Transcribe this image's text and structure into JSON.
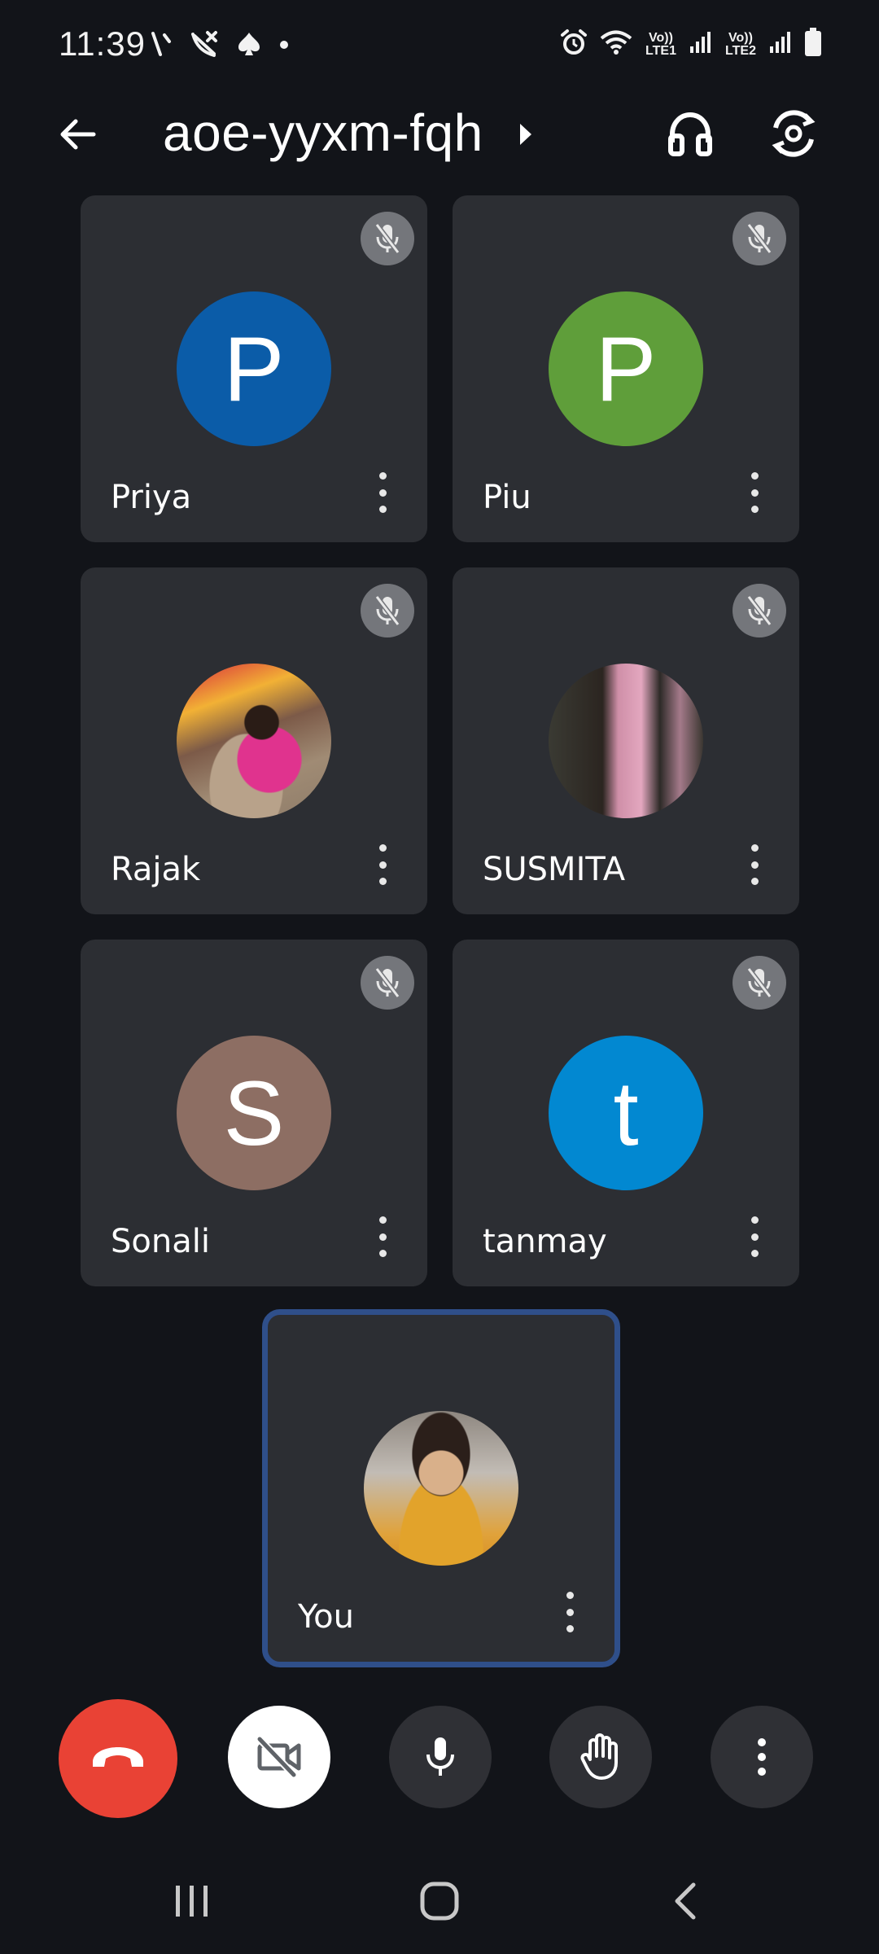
{
  "status_bar": {
    "time": "11:39",
    "icons_left": [
      "missed-call-icon",
      "no-calls-icon",
      "spade-icon",
      "dot-icon"
    ],
    "icons_right": [
      "alarm-icon",
      "wifi-icon",
      "signal-icon",
      "signal-icon",
      "battery-icon"
    ],
    "sim1_label": "Vo)) LTE1",
    "sim2_label": "Vo)) LTE2"
  },
  "top_bar": {
    "meeting_code": "aoe-yyxm-fqh",
    "icons": [
      "back-arrow-icon",
      "caret-right-icon",
      "headphones-icon",
      "switch-camera-icon"
    ]
  },
  "participants": [
    {
      "name": "Priya",
      "initial": "P",
      "avatar_color": "#0b5ca8",
      "muted": true
    },
    {
      "name": "Piu",
      "initial": "P",
      "avatar_color": "#5f9e3a",
      "muted": true
    },
    {
      "name": "Rajak",
      "initial": "",
      "avatar": "photo",
      "muted": true
    },
    {
      "name": "SUSMITA",
      "initial": "",
      "avatar": "photo",
      "muted": true
    },
    {
      "name": "Sonali",
      "initial": "S",
      "avatar_color": "#8d6e63",
      "muted": true
    },
    {
      "name": "tanmay",
      "initial": "t",
      "avatar_color": "#0288d1",
      "muted": true
    }
  ],
  "self_tile": {
    "name": "You",
    "avatar": "photo",
    "highlight_color": "#2f4f8a"
  },
  "controls": {
    "end_call_color": "#e94235",
    "icons": [
      "end-call-icon",
      "camera-off-icon",
      "microphone-icon",
      "raise-hand-icon",
      "more-options-icon"
    ]
  },
  "nav_bar": {
    "icons": [
      "recent-apps-icon",
      "home-icon",
      "back-icon"
    ]
  }
}
